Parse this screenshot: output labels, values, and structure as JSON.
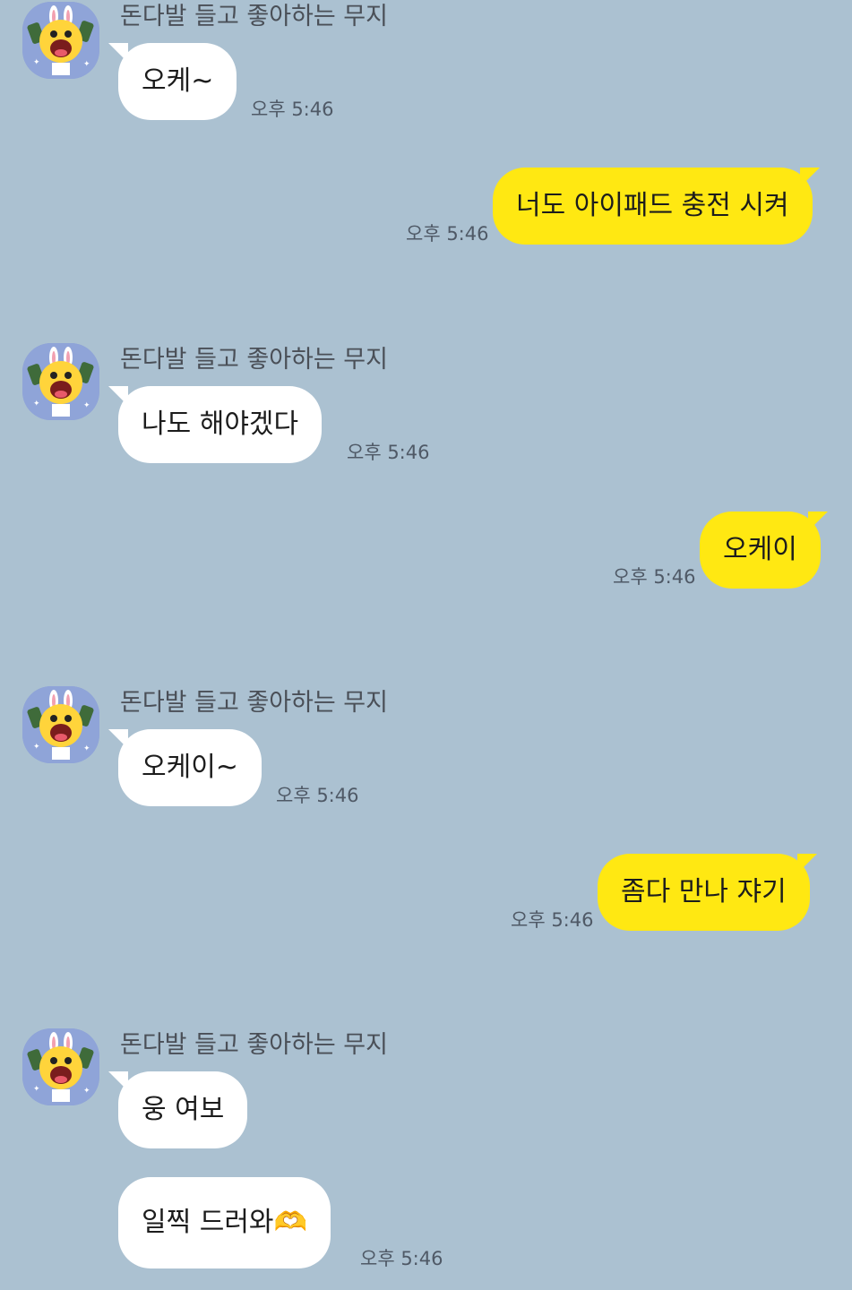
{
  "colors": {
    "background": "#abc1d1",
    "incoming_bubble": "#ffffff",
    "outgoing_bubble": "#ffe812",
    "avatar_bg": "#8fa4d8"
  },
  "messages": [
    {
      "sender": "돈다발 들고 좋아하는 무지",
      "text": "오케~",
      "time": "오후 5:46"
    },
    {
      "text": "너도 아이패드 충전 시켜",
      "time": "오후 5:46"
    },
    {
      "sender": "돈다발 들고 좋아하는 무지",
      "text": "나도 해야겠다",
      "time": "오후 5:46"
    },
    {
      "text": "오케이",
      "time": "오후 5:46"
    },
    {
      "sender": "돈다발 들고 좋아하는 무지",
      "text": "오케이~",
      "time": "오후 5:46"
    },
    {
      "text": "좀다 만나 쟈기",
      "time": "오후 5:46"
    },
    {
      "sender": "돈다발 들고 좋아하는 무지",
      "text": "웅 여보"
    },
    {
      "text": "일찍 드러와🫶",
      "time": "오후 5:46"
    }
  ]
}
